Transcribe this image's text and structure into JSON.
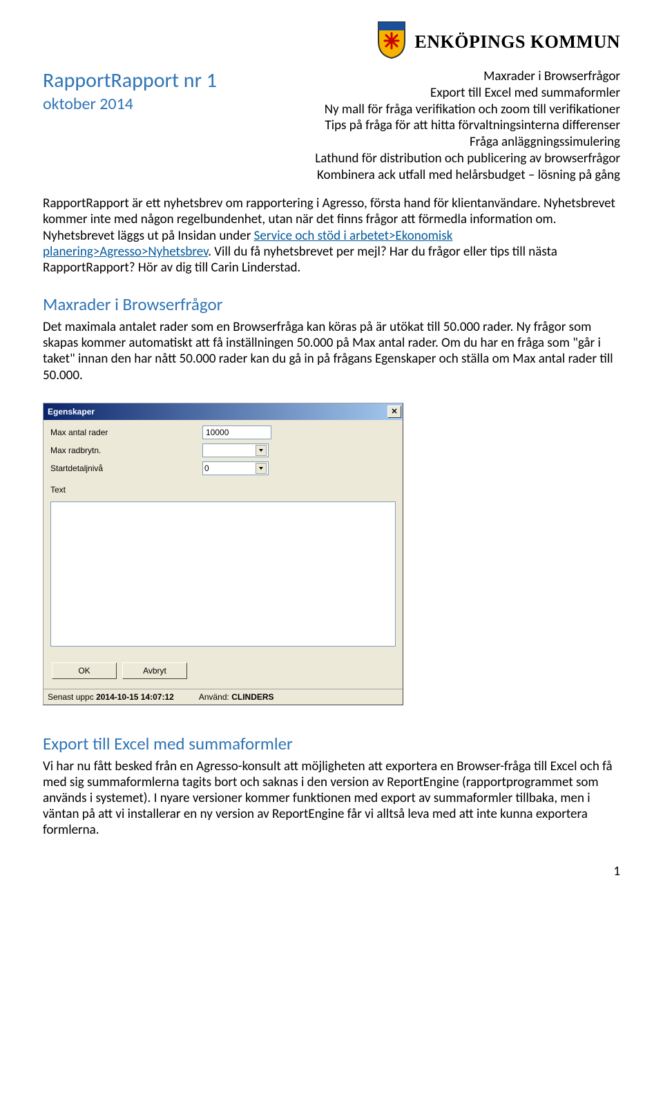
{
  "logo": {
    "text": "ENKÖPINGS KOMMUN"
  },
  "header": {
    "title": "RapportRapport nr 1",
    "subtitle": "oktober 2014",
    "bullets": [
      "Maxrader i Browserfrågor",
      "Export till Excel med summaformler",
      "Ny mall för fråga verifikation och zoom till verifikationer",
      "Tips på fråga för att hitta förvaltningsinterna differenser",
      "Fråga anläggningssimulering",
      "Lathund för distribution och publicering av browserfrågor",
      "Kombinera ack utfall med helårsbudget – lösning på gång"
    ]
  },
  "intro": {
    "part1": "RapportRapport är ett nyhetsbrev om rapportering i Agresso, första hand för klientanvändare. Nyhetsbrevet kommer inte med någon regelbundenhet, utan när det finns frågor att förmedla information om. Nyhetsbrevet läggs ut på Insidan under ",
    "link": "Service och stöd i arbetet>Ekonomisk planering>Agresso>Nyhetsbrev",
    "part2": ". Vill du få nyhetsbrevet per mejl? Har du frågor eller tips till nästa RapportRapport? Hör av dig till Carin Linderstad."
  },
  "section1": {
    "heading": "Maxrader i Browserfrågor",
    "body": "Det maximala antalet rader som en Browserfråga kan köras på är utökat till 50.000 rader. Ny frågor som skapas kommer automatiskt att få inställningen 50.000 på Max antal rader. Om du har en fråga som \"går i taket\" innan den har nått 50.000 rader kan du gå in på frågans Egenskaper och ställa om Max antal rader till 50.000."
  },
  "dialog": {
    "title": "Egenskaper",
    "rows": {
      "maxrows_label": "Max antal rader",
      "maxrows_value": "10000",
      "maxbreak_label": "Max radbrytn.",
      "maxbreak_value": "",
      "startdetail_label": "Startdetaljnivå",
      "startdetail_value": "0"
    },
    "text_label": "Text",
    "text_value": "",
    "buttons": {
      "ok": "OK",
      "cancel": "Avbryt"
    },
    "status": {
      "updated_label": "Senast uppc",
      "updated_value": "2014-10-15 14:07:12",
      "user_label": "Använd:",
      "user_value": "CLINDERS"
    }
  },
  "section2": {
    "heading": "Export till Excel med summaformler",
    "body": "Vi har nu fått besked från en Agresso-konsult att möjligheten att exportera en Browser-fråga till Excel och få med sig summaformlerna tagits bort och saknas i den version av ReportEngine (rapportprogrammet som används i systemet). I nyare versioner kommer funktionen med export av summaformler tillbaka, men i väntan på att vi installerar en ny version av ReportEngine får vi alltså leva med att inte kunna exportera formlerna."
  },
  "page_number": "1"
}
